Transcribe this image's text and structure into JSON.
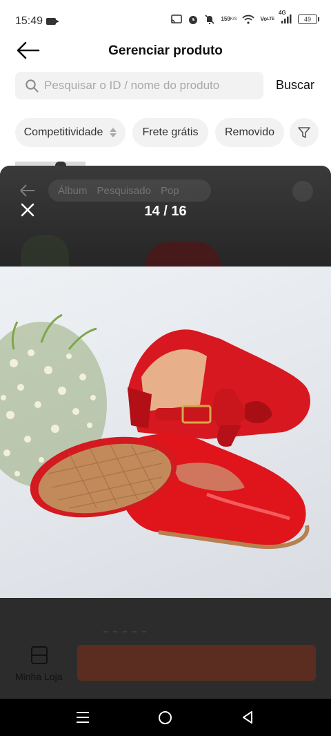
{
  "status_bar": {
    "time": "15:49",
    "network_speed_value": "159",
    "network_speed_unit": "K/S",
    "volte_top": "Vo",
    "volte_bottom": "LTE",
    "signal_label": "4G",
    "battery": "49"
  },
  "header": {
    "title": "Gerenciar produto"
  },
  "search": {
    "placeholder": "Pesquisar o ID / nome do produto",
    "button_label": "Buscar"
  },
  "filters": {
    "competitividade": "Competitividade",
    "frete_gratis": "Frete grátis",
    "removido": "Removido"
  },
  "viewer": {
    "ghost_tabs": [
      "Álbum",
      "Pesquisado",
      "Pop"
    ],
    "counter": "14 / 16",
    "current_index": 14,
    "total": 16
  },
  "bottom": {
    "store_label": "Minha Loja"
  },
  "colors": {
    "overlay": "#2b2b2b",
    "shoe_red": "#e0141b"
  }
}
